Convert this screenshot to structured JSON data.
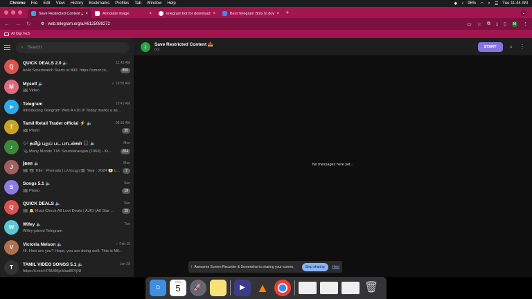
{
  "menubar": {
    "items": [
      "Chrome",
      "File",
      "Edit",
      "View",
      "History",
      "Bookmarks",
      "Profiles",
      "Tab",
      "Window",
      "Help"
    ],
    "battery": "96%",
    "clock": "Tue 11:44 AM"
  },
  "tabs": [
    {
      "title": "Save Restricted Content 📥",
      "color": "#2aabee"
    },
    {
      "title": "Annotate image",
      "color": "#ffffff"
    },
    {
      "title": "telegram bot for downloadi...",
      "color": "#ffffff"
    },
    {
      "title": "Best Telegram Bots to downl...",
      "color": "#4285f4"
    }
  ],
  "address": {
    "url": "web.telegram.org/a/#6125089272"
  },
  "bookmarks": {
    "folder": "All Digi Tech"
  },
  "sidebar": {
    "search_placeholder": "Search",
    "chats": [
      {
        "name": "QUICK DEALS 2.0 🔈",
        "time": "11:42 AM",
        "preview": "boAt Smartwatch Starts at 899. https://amzn.to...",
        "badge": "850",
        "initial": "Q",
        "color": "#d9534f"
      },
      {
        "name": "Myself 🔈",
        "time": "✓ 10:58 AM",
        "preview": "🖼 Video",
        "badge": "",
        "initial": "M",
        "color": "#e06a7a"
      },
      {
        "name": "Telegram",
        "time": "10:41 AM",
        "preview": "Introducing Telegram Web A v10.0! Today marks a sp...",
        "badge": "",
        "initial": "➤",
        "color": "#2aabee"
      },
      {
        "name": "Tamil Retail Trader official ⚡ 🔈",
        "time": "08:39 AM",
        "preview": "🖼 Photo",
        "badge": "35",
        "initial": "T",
        "color": "#c8a227"
      },
      {
        "name": "🎶 தமிழ் புதுப் பட பாடல்கள் 🎧 🔈",
        "time": "Mon",
        "preview": "📎 Many Moods T.M. Soundararajan (1960) - Ki...",
        "badge": "204",
        "initial": "♪",
        "color": "#3a8a3a"
      },
      {
        "name": "𝕛𝕠𝕖𝕖 🔈",
        "time": "Mon",
        "preview": "🖼 📽 Title : Premalu | ப்ரேமலு 🎬 Year : 2024 📀 L...",
        "badge": "7",
        "initial": "J",
        "color": "#a06060"
      },
      {
        "name": "Songs 5.1 🔈",
        "time": "Sun",
        "preview": "🖼 Photo",
        "badge": "19",
        "initial": "S",
        "color": "#8c7ae6"
      },
      {
        "name": "QUICK DEALS 🔈",
        "time": "Sun",
        "preview": "🖼 🔔 Must Check All Loot Deals | AJIO (All Star ...",
        "badge": "15",
        "initial": "Q",
        "color": "#d9534f"
      },
      {
        "name": "Wifey 🔈",
        "time": "Tue",
        "preview": "Wifey joined Telegram",
        "badge": "",
        "initial": "W",
        "color": "#5ac8d8"
      },
      {
        "name": "Victoria Nelson 🔈",
        "time": "✓ Feb 15",
        "preview": "Hi. How are you? Hope, you are doing well. This is Mil...",
        "badge": "",
        "initial": "V",
        "color": "#b07050"
      },
      {
        "name": "TAMIL VIDEO SONGS 5.1 🔈",
        "time": "Jan 28",
        "preview": "https://t.me/+P9U06jxMae85YjNl",
        "badge": "",
        "initial": "T",
        "color": "#333333"
      }
    ]
  },
  "chat": {
    "title": "Save Restricted Content 📥",
    "subtitle": "bot",
    "start_label": "START",
    "empty_text": "No messages here yet..."
  },
  "share": {
    "text": "Awesome Screen Recorder & Screenshot is sharing your screen.",
    "stop_label": "Stop sharing",
    "hide_label": "Hide"
  },
  "dock": {
    "calendar_month": "FEB",
    "calendar_day": "5"
  }
}
